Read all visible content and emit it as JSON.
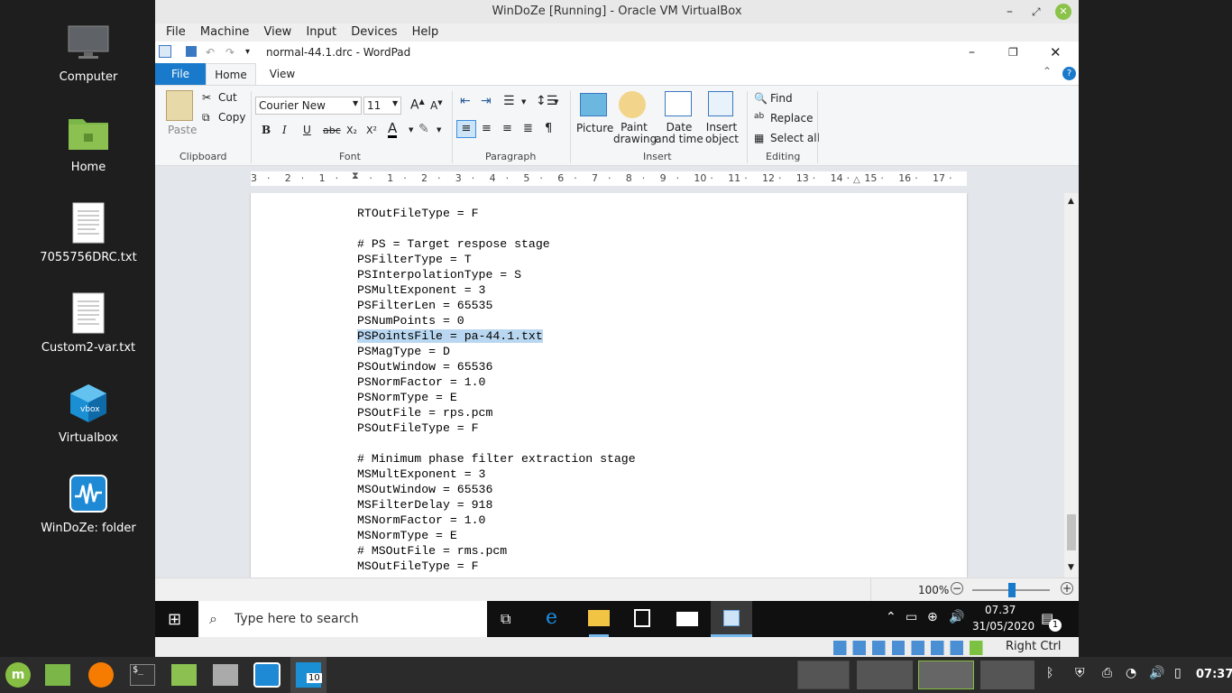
{
  "desktop": {
    "icons": [
      {
        "label": "Computer"
      },
      {
        "label": "Home"
      },
      {
        "label": "7055756DRC.txt"
      },
      {
        "label": "Custom2-var.txt"
      },
      {
        "label": "Virtualbox"
      },
      {
        "label": "WinDoZe: folder"
      }
    ]
  },
  "vbox": {
    "title": "WinDoZe [Running] - Oracle VM VirtualBox",
    "menu": [
      "File",
      "Machine",
      "View",
      "Input",
      "Devices",
      "Help"
    ],
    "status_key": "Right Ctrl"
  },
  "wordpad": {
    "title": "normal-44.1.drc - WordPad",
    "tabs": {
      "file": "File",
      "home": "Home",
      "view": "View"
    },
    "clipboard": {
      "paste": "Paste",
      "cut": "Cut",
      "copy": "Copy",
      "label": "Clipboard"
    },
    "font": {
      "name": "Courier New",
      "size": "11",
      "label": "Font",
      "bold": "B",
      "italic": "I",
      "underline": "U",
      "strike": "abc",
      "sub": "X₂",
      "sup": "X²"
    },
    "paragraph": {
      "label": "Paragraph"
    },
    "insert": {
      "picture": "Picture",
      "paint": "Paint drawing",
      "datetime": "Date and time",
      "object": "Insert object",
      "label": "Insert"
    },
    "editing": {
      "find": "Find",
      "replace": "Replace",
      "select_all": "Select all",
      "label": "Editing"
    },
    "ruler": [
      "3",
      "2",
      "1",
      "",
      "1",
      "2",
      "3",
      "4",
      "5",
      "6",
      "7",
      "8",
      "9",
      "10",
      "11",
      "12",
      "13",
      "14",
      "15",
      "16",
      "17"
    ],
    "lines": [
      "RTOutFileType = F",
      "",
      "# PS = Target respose stage",
      "PSFilterType = T",
      "PSInterpolationType = S",
      "PSMultExponent = 3",
      "PSFilterLen = 65535",
      "PSNumPoints = 0",
      "PSPointsFile = pa-44.1.txt",
      "PSMagType = D",
      "PSOutWindow = 65536",
      "PSNormFactor = 1.0",
      "PSNormType = E",
      "PSOutFile = rps.pcm",
      "PSOutFileType = F",
      "",
      "# Minimum phase filter extraction stage",
      "MSMultExponent = 3",
      "MSOutWindow = 65536",
      "MSFilterDelay = 918",
      "MSNormFactor = 1.0",
      "MSNormType = E",
      "# MSOutFile = rms.pcm",
      "MSOutFileType = F"
    ],
    "zoom": "100%"
  },
  "win_taskbar": {
    "search_placeholder": "Type here to search",
    "time": "07.37",
    "date": "31/05/2020",
    "notif_count": "1"
  },
  "host_taskbar": {
    "time": "07:37",
    "vbox_badge": "10"
  }
}
